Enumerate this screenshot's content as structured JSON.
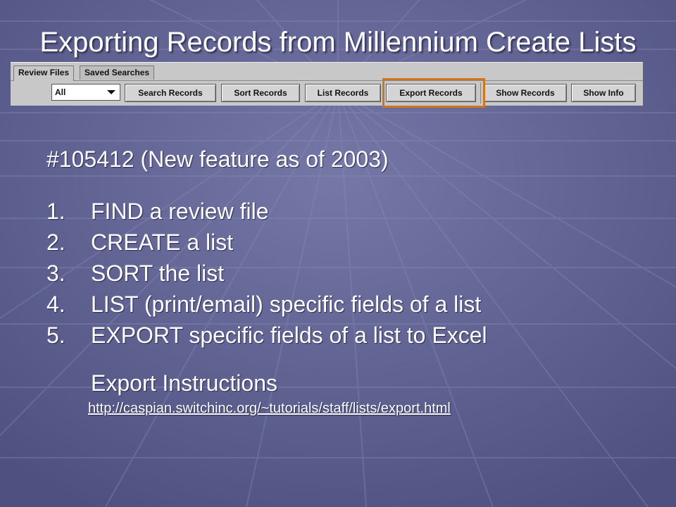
{
  "title": "Exporting Records from Millennium Create Lists",
  "toolbar": {
    "tabs": [
      "Review Files",
      "Saved Searches"
    ],
    "select_value": "All",
    "buttons": [
      "Search Records",
      "Sort Records",
      "List Records",
      "Export Records",
      "Show Records",
      "Show Info"
    ]
  },
  "feature": "#105412 (New feature as of 2003)",
  "steps": [
    {
      "num": "1.",
      "text": "FIND a review file"
    },
    {
      "num": "2.",
      "text": "CREATE a list"
    },
    {
      "num": "3.",
      "text": "SORT the list"
    },
    {
      "num": "4.",
      "text": "LIST (print/email) specific fields of a list"
    },
    {
      "num": "5.",
      "text": "EXPORT specific fields of a list to Excel"
    }
  ],
  "instructions_label": "Export Instructions",
  "instructions_link": "http://caspian.switchinc.org/~tutorials/staff/lists/export.html",
  "colors": {
    "background": "#5a5c8c",
    "highlight": "#d0741e",
    "text": "#ffffff"
  }
}
